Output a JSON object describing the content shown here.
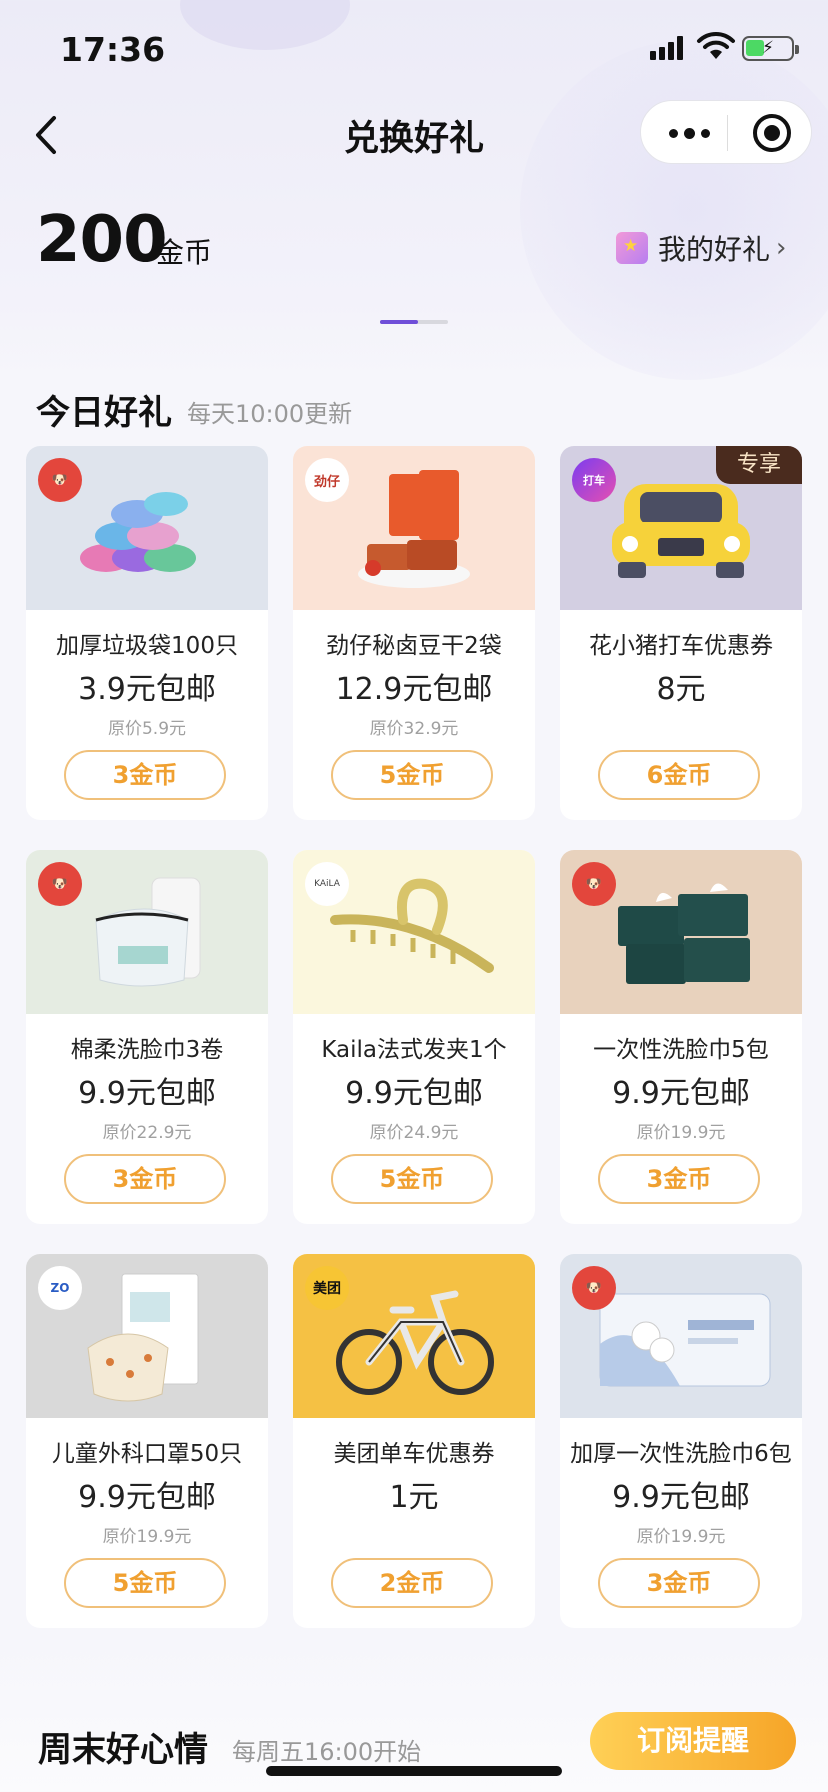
{
  "status_bar": {
    "time": "17:36"
  },
  "nav": {
    "title": "兑换好礼"
  },
  "coins": {
    "amount": "200",
    "unit": "金币"
  },
  "my_gifts": {
    "label": "我的好礼"
  },
  "today": {
    "title": "今日好礼",
    "subtitle": "每天10:00更新"
  },
  "items": [
    {
      "name": "加厚垃圾袋100只",
      "price": "3.9元包邮",
      "original": "原价5.9元",
      "cost": "3金币",
      "logo": "jd-logo-icon"
    },
    {
      "name": "劲仔秘卤豆干2袋",
      "price": "12.9元包邮",
      "original": "原价32.9元",
      "cost": "5金币",
      "logo_text": "劲仔"
    },
    {
      "name": "花小猪打车优惠券",
      "price": "8元",
      "original": "",
      "cost": "6金币",
      "badge": "专享",
      "logo_text": "打车"
    },
    {
      "name": "棉柔洗脸巾3卷",
      "price": "9.9元包邮",
      "original": "原价22.9元",
      "cost": "3金币",
      "logo": "jd-logo-icon"
    },
    {
      "name": "Kaila法式发夹1个",
      "price": "9.9元包邮",
      "original": "原价24.9元",
      "cost": "5金币",
      "logo_text": "KAiLA"
    },
    {
      "name": "一次性洗脸巾5包",
      "price": "9.9元包邮",
      "original": "原价19.9元",
      "cost": "3金币",
      "logo": "jd-logo-icon"
    },
    {
      "name": "儿童外科口罩50只",
      "price": "9.9元包邮",
      "original": "原价19.9元",
      "cost": "5金币",
      "logo_text": "ZO"
    },
    {
      "name": "美团单车优惠券",
      "price": "1元",
      "original": "",
      "cost": "2金币",
      "logo_text": "美团"
    },
    {
      "name": "加厚一次性洗脸巾6包",
      "price": "9.9元包邮",
      "original": "原价19.9元",
      "cost": "3金币",
      "logo": "jd-logo-icon"
    }
  ],
  "weekend": {
    "title": "周末好心情",
    "subtitle": "每周五16:00开始",
    "subscribe_label": "订阅提醒"
  },
  "colors": {
    "accent": "#f0a030",
    "primary": "#6f4ed8",
    "badge_bg": "#4a2b1e"
  }
}
